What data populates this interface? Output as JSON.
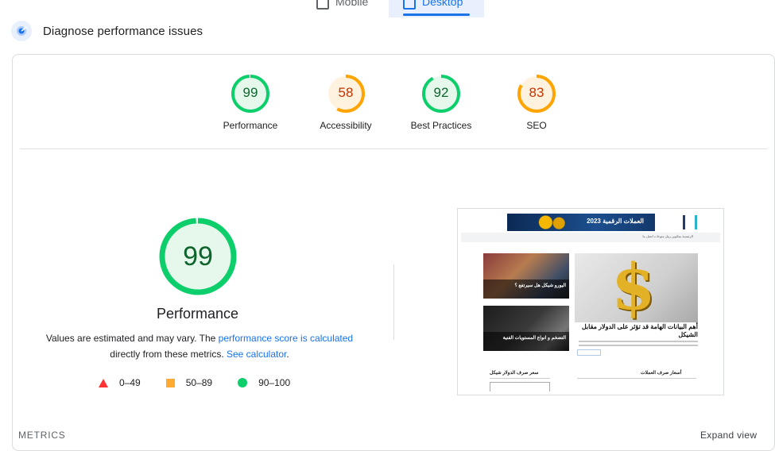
{
  "tabs": [
    {
      "label": "Mobile",
      "icon": "mobile-phone-icon",
      "selected": false
    },
    {
      "label": "Desktop",
      "icon": "desktop-monitor-icon",
      "selected": true
    }
  ],
  "diagnose": {
    "title": "Diagnose performance issues",
    "icon": "lighthouse-icon"
  },
  "scores": [
    {
      "label": "Performance",
      "value": 99,
      "color": "#0cce6b",
      "bg": "#e6f7ec",
      "text_color": "#0d652d"
    },
    {
      "label": "Accessibility",
      "value": 58,
      "color": "#ffa400",
      "bg": "#fff3e0",
      "text_color": "#c33300"
    },
    {
      "label": "Best Practices",
      "value": 92,
      "color": "#0cce6b",
      "bg": "#e6f7ec",
      "text_color": "#0d652d"
    },
    {
      "label": "SEO",
      "value": 83,
      "color": "#ffa400",
      "bg": "#fff3e0",
      "text_color": "#c33300"
    }
  ],
  "performance": {
    "score": 99,
    "title": "Performance",
    "note_prefix": "Values are estimated and may vary. The ",
    "note_link1": "performance score is calculated",
    "note_middle": " directly from these metrics. ",
    "note_link2": "See calculator",
    "note_suffix": "."
  },
  "legend": [
    {
      "shape": "triangle",
      "range": "0–49",
      "color": "#ff3333"
    },
    {
      "shape": "square",
      "range": "50–89",
      "color": "#ffaa33"
    },
    {
      "shape": "circle",
      "range": "90–100",
      "color": "#0cce6b"
    }
  ],
  "screenshot": {
    "banner_text": "العملات الرقمية 2023",
    "nav_text": "الرئيسية   بيتكوين   ريبل   منوعات   اتصل بنا",
    "headline": "أهم البيانات الهامة قد تؤثر على الدولار مقابل الشيكل",
    "card_a": "اليورو شيكل هل سيرتفع ؟",
    "card_b": "التضخم و انواع المستويات الفنية",
    "section_right": "أسعار صرف العملات",
    "section_left": "سعر صرف الدولار شيكل"
  },
  "footer": {
    "metrics_label": "METRICS",
    "expand_label": "Expand view"
  }
}
